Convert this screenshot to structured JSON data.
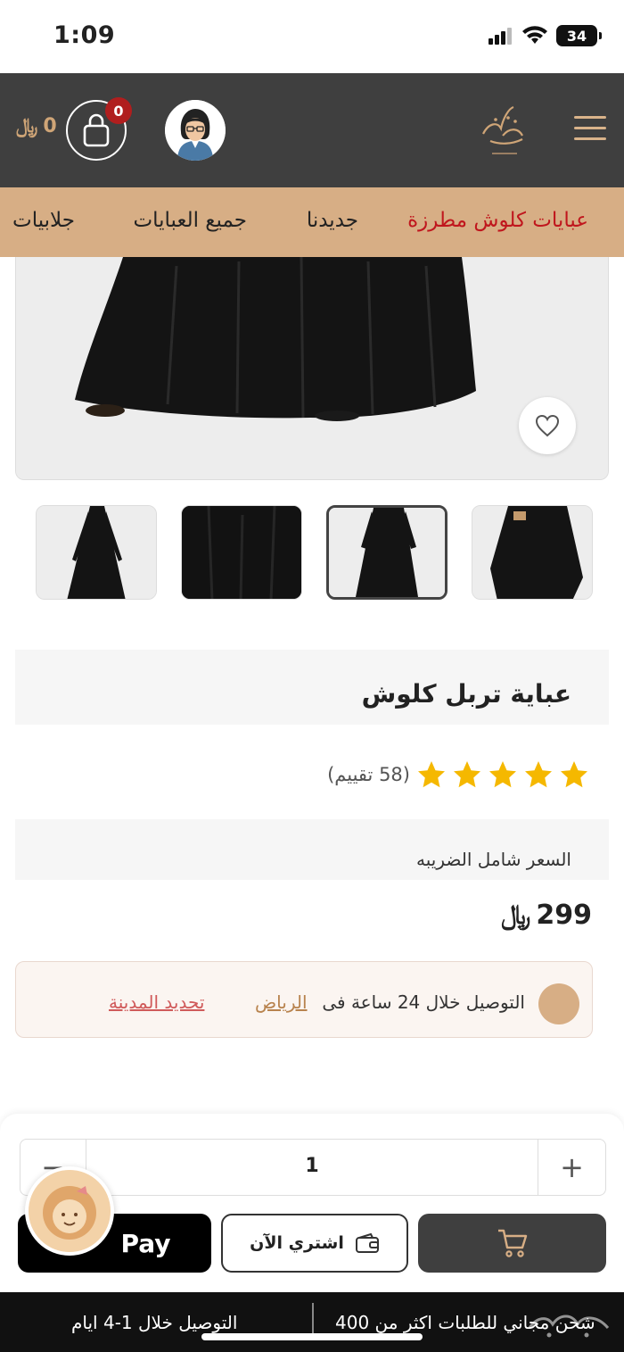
{
  "status_bar": {
    "time": "1:09",
    "battery": "34"
  },
  "header": {
    "cart_total": "0",
    "currency_symbol": "﷼",
    "cart_count": "0",
    "icons": [
      "menu-icon",
      "logo",
      "avatar",
      "shopping-bag-icon"
    ]
  },
  "categories": [
    {
      "label": "عبايات كلوش مطرزة",
      "active": true
    },
    {
      "label": "جديدنا",
      "active": false
    },
    {
      "label": "جميع العبايات",
      "active": false
    },
    {
      "label": "جلابيات",
      "active": false
    }
  ],
  "product": {
    "title": "عباية تربل كلوش",
    "rating_stars": 5,
    "rating_count": "(58 تقييم)",
    "price_label": "السعر شامل الضريبه",
    "price": "299",
    "currency_symbol": "﷼"
  },
  "delivery": {
    "text": "التوصيل خلال 24 ساعة فى",
    "city": "الرياض",
    "change_city": "تحديد المدينة"
  },
  "quantity": {
    "value": "1",
    "minus": "−",
    "plus": "+"
  },
  "actions": {
    "pay_label": "Pay",
    "buy_now_label": "اشتري الآن"
  },
  "footer": {
    "delivery_note": "التوصيل خلال 1-4 ايام",
    "free_shipping": "شحن مجاني للطلبات اكثر من 400"
  },
  "colors": {
    "header_bg": "#3f3f3f",
    "category_bg": "#d7ae85",
    "accent_red": "#c0161d",
    "star": "#f5b800"
  }
}
